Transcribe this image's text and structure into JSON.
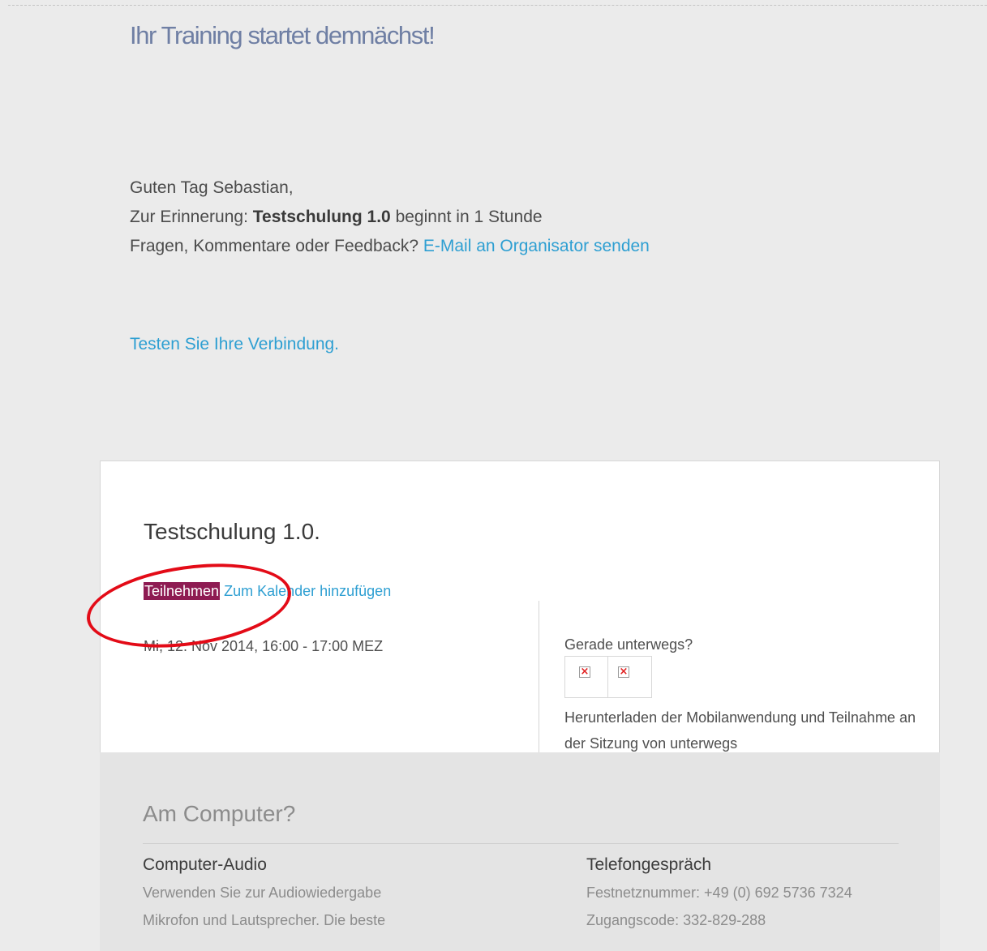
{
  "header": {
    "title": "Ihr Training startet demnächst!"
  },
  "greeting": {
    "salutation": "Guten Tag Sebastian,",
    "reminder_prefix": "Zur Erinnerung: ",
    "training_name": "Testschulung 1.0",
    "reminder_suffix": " beginnt in 1 Stunde",
    "feedback_prefix": "Fragen, Kommentare oder Feedback? ",
    "feedback_link": "E-Mail an Organisator senden"
  },
  "connection_test_link": "Testen Sie Ihre Verbindung.",
  "session": {
    "title": "Testschulung 1.0.",
    "join_label": "Teilnehmen",
    "calendar_label": "Zum Kalender hinzufügen",
    "date": "Mi, 12. Nov 2014, 16:00 - 17:00 MEZ"
  },
  "mobile": {
    "heading": "Gerade unterwegs?",
    "icons": [
      "broken-image-icon",
      "broken-image-icon"
    ],
    "text": "Herunterladen der Mobilanwendung und Teilnahme an der Sitzung von unterwegs"
  },
  "computer": {
    "heading": "Am Computer?",
    "audio_title": "Computer-Audio",
    "audio_text": "Verwenden Sie zur Audiowiedergabe Mikrofon und Lautsprecher. Die beste",
    "phone_title": "Telefongespräch",
    "phone_number_line": "Festnetznummer: +49 (0) 692 5736 7324",
    "access_code_line": "Zugangscode: 332-829-288"
  },
  "colors": {
    "title": "#6f7fa4",
    "link": "#2e9fd2",
    "join_button": "#8e1b52",
    "annotation": "#e30b17"
  }
}
